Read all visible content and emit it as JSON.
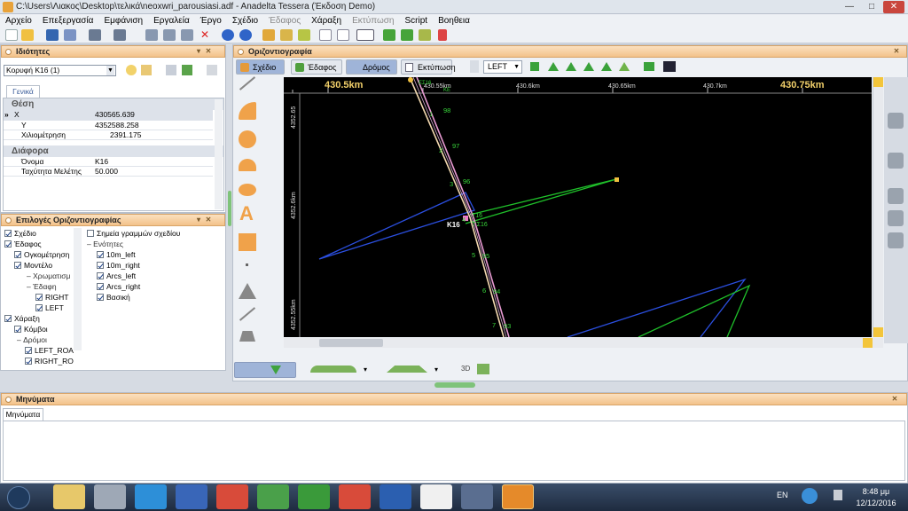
{
  "window": {
    "title": "C:\\Users\\Λιακος\\Desktop\\τελικά\\neoxwri_parousiasi.adf - Anadelta Tessera (Έκδοση Demo)",
    "minimize": "—",
    "maximize": "□",
    "close": "✕"
  },
  "menu": [
    "Αρχείο",
    "Επεξεργασία",
    "Εμφάνιση",
    "Εργαλεία",
    "Έργο",
    "Σχέδιο",
    "Έδαφος",
    "Χάραξη",
    "Εκτύπωση",
    "Script",
    "Βοηθεια"
  ],
  "properties": {
    "header": "Ιδιότητες",
    "selector_value": "Κορυφή Κ16 (1)",
    "tab": "Γενικά",
    "section1": "Θέση",
    "rows1": [
      {
        "label": "Χ",
        "value": "430565.639"
      },
      {
        "label": "Υ",
        "value": "4352588.258"
      },
      {
        "label": "Χιλιομέτρηση",
        "value": "2391.175"
      }
    ],
    "section2": "Διάφορα",
    "rows2": [
      {
        "label": "Όνομα",
        "value": "Κ16"
      },
      {
        "label": "Ταχύτητα Μελέτης",
        "value": "50.000"
      }
    ]
  },
  "options": {
    "header": "Επιλογές Οριζοντιογραφίας",
    "left_tree": [
      {
        "label": "Σχέδιο",
        "checked": true
      },
      {
        "label": "Έδαφος",
        "checked": true
      },
      {
        "label": "Ογκομέτρηση",
        "checked": true
      },
      {
        "label": "Μοντέλο",
        "checked": true
      },
      {
        "label": "Χρωματισμ",
        "checked": null
      },
      {
        "label": "Έδαφη",
        "checked": null
      },
      {
        "label": "RIGHT",
        "checked": true
      },
      {
        "label": "LEFT",
        "checked": true
      },
      {
        "label": "Χάραξη",
        "checked": true
      },
      {
        "label": "Κόμβοι",
        "checked": true
      },
      {
        "label": "Δρόμοι",
        "checked": null
      },
      {
        "label": "LEFT_ROA",
        "checked": true
      },
      {
        "label": "RIGHT_RO",
        "checked": true
      }
    ],
    "right_tree": [
      {
        "label": "Σημεία γραμμών σχεδίου",
        "checked": false
      },
      {
        "label": "Ενότητες",
        "checked": null
      },
      {
        "label": "10m_left",
        "checked": true
      },
      {
        "label": "10m_right",
        "checked": true
      },
      {
        "label": "Arcs_left",
        "checked": true
      },
      {
        "label": "Arcs_right",
        "checked": true
      },
      {
        "label": "Βασική",
        "checked": true
      }
    ]
  },
  "plan": {
    "header": "Οριζοντιογραφία",
    "tabs": [
      "Σχέδιο",
      "Έδαφος",
      "Δρόμος",
      "Εκτύπωση"
    ],
    "view_select": "LEFT",
    "ruler_big": [
      "430.5km",
      "430.75km"
    ],
    "ruler_small": [
      "430.55km",
      "430.6km",
      "430.65km",
      "430.7km"
    ],
    "ruler_vertical": [
      "4352.65",
      "4352.6km",
      "4352.55km"
    ],
    "vertex_label": "K16",
    "stations": [
      "98",
      "97",
      "96",
      "95",
      "94",
      "93",
      "1",
      "2",
      "3",
      "4",
      "5",
      "6",
      "7"
    ],
    "curve_labels": [
      "T16",
      "ΕΣ16",
      "Τ'Σ16",
      "ΚΕ"
    ],
    "button_3d": "3D"
  },
  "messages": {
    "header": "Μηνύματα",
    "tab": "Μηνύματα"
  },
  "taskbar": {
    "lang": "EN",
    "time": "8:48 μμ",
    "date": "12/12/2016"
  },
  "colors": {
    "panel_header": "#f3c28a",
    "canvas_bg": "#000000",
    "road_line": "#f4d9b0",
    "green_line": "#1fbf2a",
    "blue_line": "#2b4fe0",
    "station_text": "#37d43a"
  }
}
